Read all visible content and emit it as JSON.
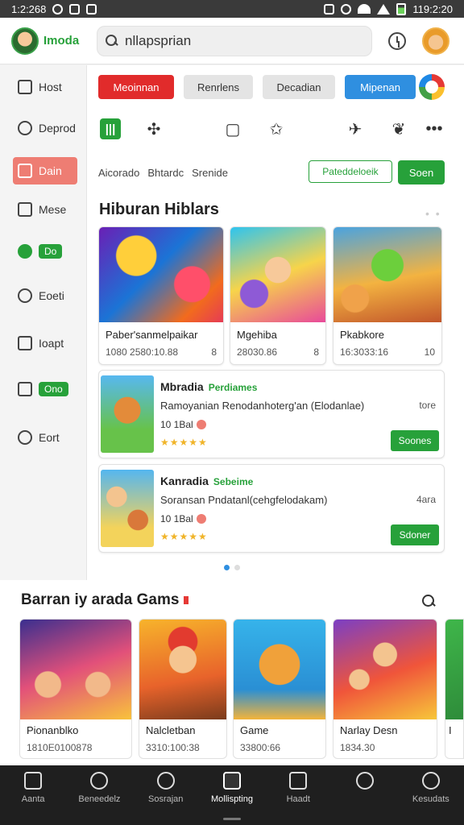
{
  "status_bar": {
    "time_left": "1:2:268",
    "time_right": "119:2:20"
  },
  "header": {
    "app_name": "Imoda",
    "search": {
      "value": "nllapsprian",
      "placeholder": "nllapsprian"
    }
  },
  "sidebar": {
    "items": [
      {
        "label": "Host",
        "icon": "page-icon"
      },
      {
        "label": "Deprod",
        "icon": "hand-icon"
      },
      {
        "label": "Dain",
        "icon": "person-icon",
        "active": true
      },
      {
        "label": "Mese",
        "icon": "square-icon"
      },
      {
        "label": "Do",
        "icon": "chat-icon",
        "pill": true
      },
      {
        "label": "Eoeti",
        "icon": "shield-icon"
      },
      {
        "label": "Ioapt",
        "icon": "bookmark-icon"
      },
      {
        "label": "Ono",
        "icon": "group-icon",
        "pill": true
      },
      {
        "label": "Eort",
        "icon": "gear-icon"
      }
    ]
  },
  "chips": [
    "Meoinnan",
    "Renrlens",
    "Decadian",
    "Mipenan"
  ],
  "filter": {
    "labels": [
      "Aicorado",
      "Bhtardc",
      "Srenide"
    ],
    "outline_button": "Pateddeloeik",
    "fill_button": "Soen"
  },
  "featured": {
    "title": "Hiburan Hiblars",
    "tiles": [
      {
        "name": "Paber'sanmelpaikar",
        "meta": "1080 2580:10.88",
        "count": "8"
      },
      {
        "name": "Mgehiba",
        "meta": "28030.86",
        "count": "8"
      },
      {
        "name": "Pkabkore",
        "meta": "16:3033:16",
        "count": "10"
      }
    ]
  },
  "list": [
    {
      "title": "Mbradia",
      "tag": "Perdiames",
      "desc": "Ramoyanian Renodanhoterg'an (Elodanlae)",
      "side": "tore",
      "meta": "10 1Bal",
      "stars": "★★★★★",
      "button": "Soones"
    },
    {
      "title": "Kanradia",
      "tag": "Sebeime",
      "desc": "Soransan Pndatanl(cehgfelodakam)",
      "side": "4ara",
      "meta": "10 1Bal",
      "stars": "★★★★★",
      "button": "Sdoner"
    }
  ],
  "games": {
    "title": "Barran iy arada Gams",
    "tiles": [
      {
        "name": "Pionanblko",
        "meta": "1810E0100878"
      },
      {
        "name": "Nalcletban",
        "meta": "3310:100:38"
      },
      {
        "name": "Game",
        "meta": "33800:66"
      },
      {
        "name": "Narlay Desn",
        "meta": "1834.30"
      }
    ],
    "edge_label": "I"
  },
  "bottom_nav": [
    {
      "label": "Aanta",
      "icon": "home-icon"
    },
    {
      "label": "Beneedelz",
      "icon": "person-icon"
    },
    {
      "label": "Sosrajan",
      "icon": "search-icon"
    },
    {
      "label": "Mollispting",
      "icon": "play-icon",
      "active": true
    },
    {
      "label": "Haadt",
      "icon": "lock-icon"
    },
    {
      "label": "",
      "icon": "people-icon"
    },
    {
      "label": "Kesudats",
      "icon": "search-icon"
    }
  ]
}
